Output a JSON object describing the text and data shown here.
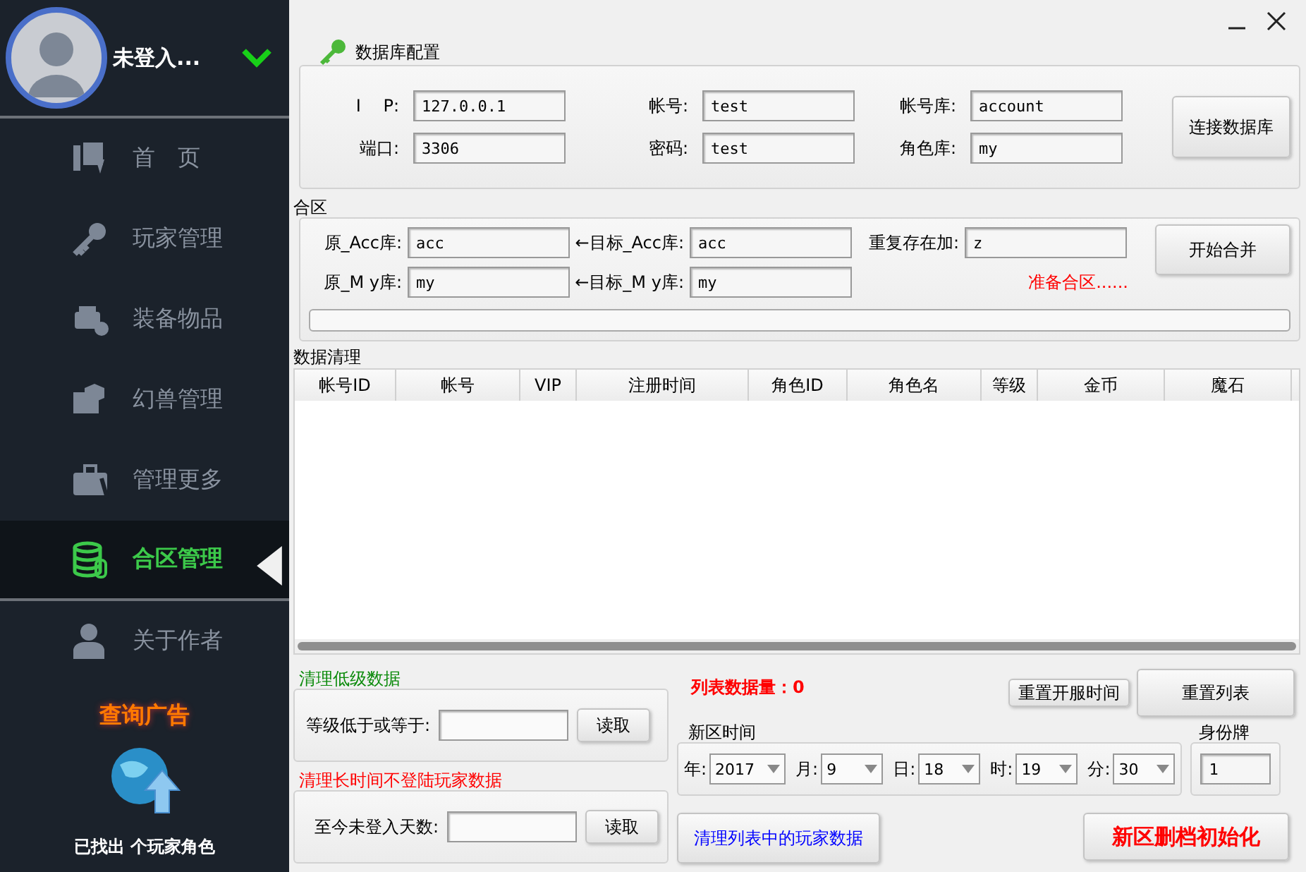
{
  "user": {
    "name": "未登入..."
  },
  "nav": [
    {
      "label": "首　页",
      "selected": false
    },
    {
      "label": "玩家管理",
      "selected": false
    },
    {
      "label": "装备物品",
      "selected": false
    },
    {
      "label": "幻兽管理",
      "selected": false
    },
    {
      "label": "管理更多",
      "selected": false
    },
    {
      "label": "合区管理",
      "selected": true
    },
    {
      "label": "关于作者",
      "selected": false
    }
  ],
  "ad": {
    "title": "查询广告",
    "found": "已找出 个玩家角色"
  },
  "db_config": {
    "title": "数据库配置",
    "fields": [
      {
        "label": "I　 P:",
        "value": "127.0.0.1"
      },
      {
        "label": "帐号:",
        "value": "test"
      },
      {
        "label": "帐号库:",
        "value": "account"
      },
      {
        "label": "端口:",
        "value": "3306"
      },
      {
        "label": "密码:",
        "value": "test"
      },
      {
        "label": "角色库:",
        "value": "my"
      }
    ],
    "button": "连接数据库"
  },
  "merge": {
    "title": "合区",
    "fields": [
      {
        "label": "原_Acc库:",
        "value": "acc"
      },
      {
        "label": "←目标_Acc库:",
        "value": "acc"
      },
      {
        "label": "重复存在加:",
        "value": "z"
      },
      {
        "label": "原_M y库:",
        "value": "my"
      },
      {
        "label": "←目标_M y库:",
        "value": "my"
      }
    ],
    "status": "准备合区......",
    "progress": {
      "level": 0
    },
    "button": "开始合并"
  },
  "cleanup": {
    "title": "数据清理",
    "columns": [
      "帐号ID",
      "帐号",
      "VIP",
      "注册时间",
      "角色ID",
      "角色名",
      "等级",
      "金币",
      "魔石"
    ]
  },
  "low_level": {
    "title": "清理低级数据",
    "label": "等级低于或等于:",
    "button": "读取"
  },
  "inactive": {
    "title": "清理长时间不登陆玩家数据",
    "label": "至今未登入天数:",
    "button": "读取"
  },
  "list_count": "列表数据量：0",
  "reset_time_button": "重置开服时间",
  "reset_list_button": "重置列表",
  "new_zone_time": {
    "title": "新区时间",
    "fields": [
      {
        "label": "年:",
        "value": "2017"
      },
      {
        "label": "月:",
        "value": "9"
      },
      {
        "label": "日:",
        "value": "18"
      },
      {
        "label": "时:",
        "value": "19"
      },
      {
        "label": "分:",
        "value": "30"
      }
    ]
  },
  "id_badge": {
    "title": "身份牌",
    "value": "1"
  },
  "clear_list_button": "清理列表中的玩家数据",
  "reset_zone_button": "新区删档初始化"
}
